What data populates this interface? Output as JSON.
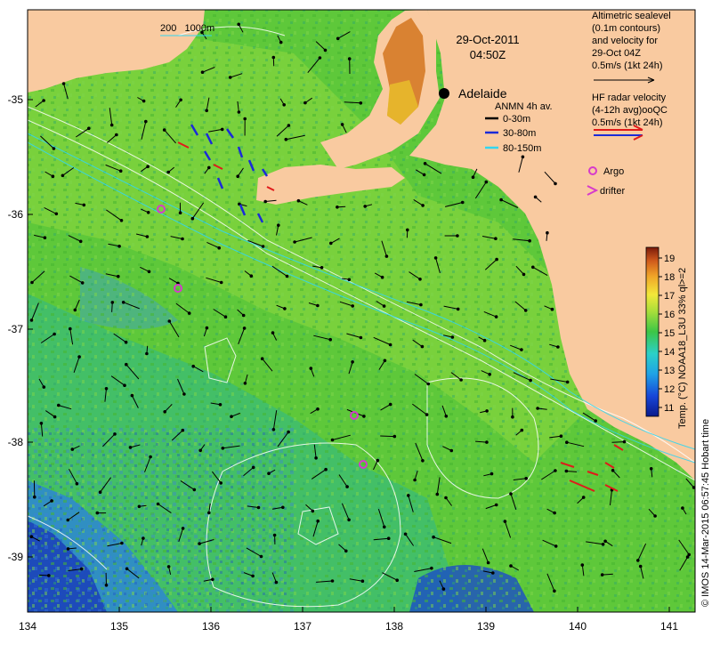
{
  "map": {
    "date": "29-Oct-2011",
    "time": "04:50Z",
    "city": "Adelaide",
    "lon_ticks": [
      "134",
      "135",
      "136",
      "137",
      "138",
      "139",
      "140",
      "141"
    ],
    "lat_ticks": [
      "-35",
      "-36",
      "-37",
      "-38",
      "-39"
    ],
    "depth_labels": "200   1000m",
    "colors": {
      "land": "#f9caa0",
      "sea_warm": "#5ec83a",
      "sea_cool": "#2fa8d8",
      "sea_cold": "#1c4fc8"
    }
  },
  "legend": {
    "altimetry": [
      "Altimetric sealevel",
      "(0.1m contours)",
      "and velocity for",
      "29-Oct 04Z",
      "0.5m/s (1kt 24h)"
    ],
    "hf_radar": [
      "HF radar velocity",
      "(4-12h avg)ooQC",
      "0.5m/s (1kt 24h)"
    ],
    "anmn_title": "ANMN 4h av.",
    "anmn_items": [
      {
        "label": "0-30m",
        "color": "#000000"
      },
      {
        "label": "30-80m",
        "color": "#1a2bd8"
      },
      {
        "label": "80-150m",
        "color": "#33d6f0"
      }
    ],
    "argo": "Argo",
    "drifter": "drifter"
  },
  "colorbar": {
    "ticks": [
      "19",
      "18",
      "17",
      "16",
      "15",
      "14",
      "13",
      "12",
      "11"
    ],
    "label": "Temp. (°C) NOAA18_L3U 33% ql>=2"
  },
  "footer": "© IMOS 14-Mar-2015 06:57:45 Hobart time"
}
